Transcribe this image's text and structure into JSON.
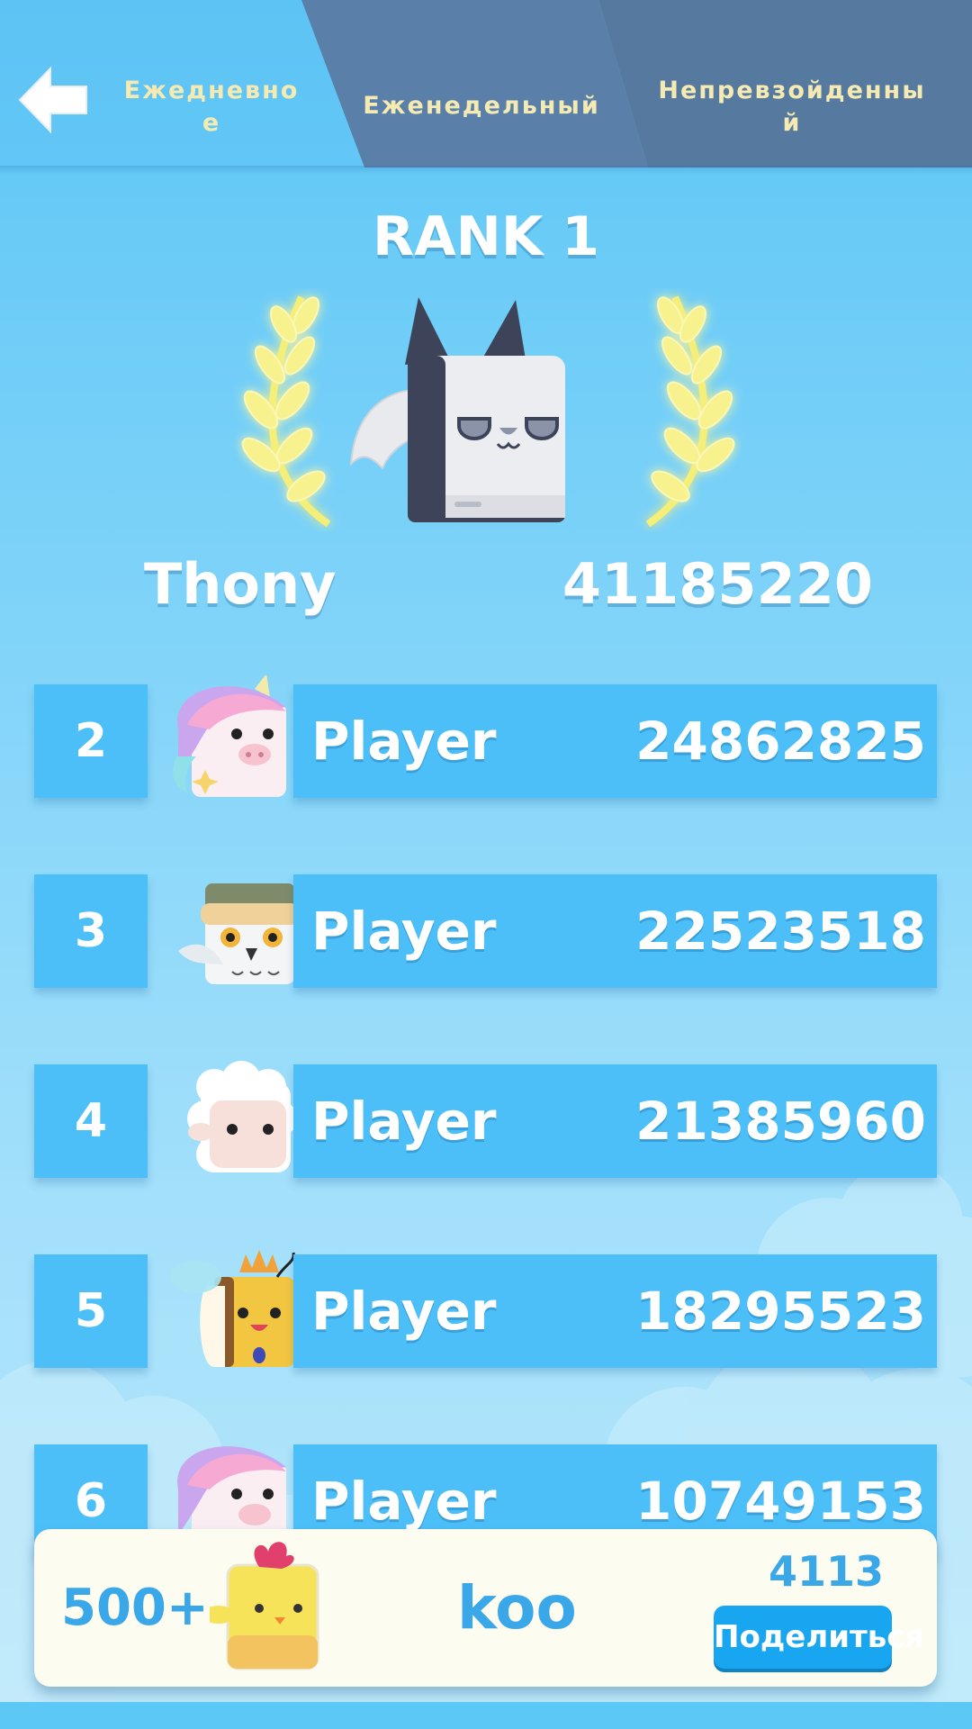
{
  "tabs": {
    "daily": "Ежедневно\nе",
    "daily_line1": "Ежедневно",
    "daily_line2": "е",
    "weekly": "Еженедельный",
    "best_line1": "Непревзойденны",
    "best_line2": "й"
  },
  "icons": {
    "back": "arrow-left-icon",
    "laurel": "laurel-icon"
  },
  "champion": {
    "rank_title": "RANK 1",
    "name": "Thony",
    "score": "41185220",
    "avatar": "bat-cube-avatar"
  },
  "rows": [
    {
      "rank": "2",
      "name": "Player",
      "score": "24862825",
      "avatar": "unicorn-pig-avatar"
    },
    {
      "rank": "3",
      "name": "Player",
      "score": "22523518",
      "avatar": "owl-avatar"
    },
    {
      "rank": "4",
      "name": "Player",
      "score": "21385960",
      "avatar": "sheep-avatar"
    },
    {
      "rank": "5",
      "name": "Player",
      "score": "18295523",
      "avatar": "bee-queen-avatar"
    },
    {
      "rank": "6",
      "name": "Player",
      "score": "10749153",
      "avatar": "unicorn-pig-avatar"
    }
  ],
  "me": {
    "rank": "500+",
    "name": "koo",
    "score": "4113",
    "avatar": "chick-avatar",
    "share_label": "Поделиться"
  },
  "colors": {
    "background": "#5cc6f5",
    "row": "#4dbff8",
    "tab_active": "#5dc3f4",
    "tab_inactive": "#5a7fa8",
    "tab_text": "#f4eab2",
    "accent_text": "#3aa8e8",
    "share_button": "#18a6f0"
  }
}
